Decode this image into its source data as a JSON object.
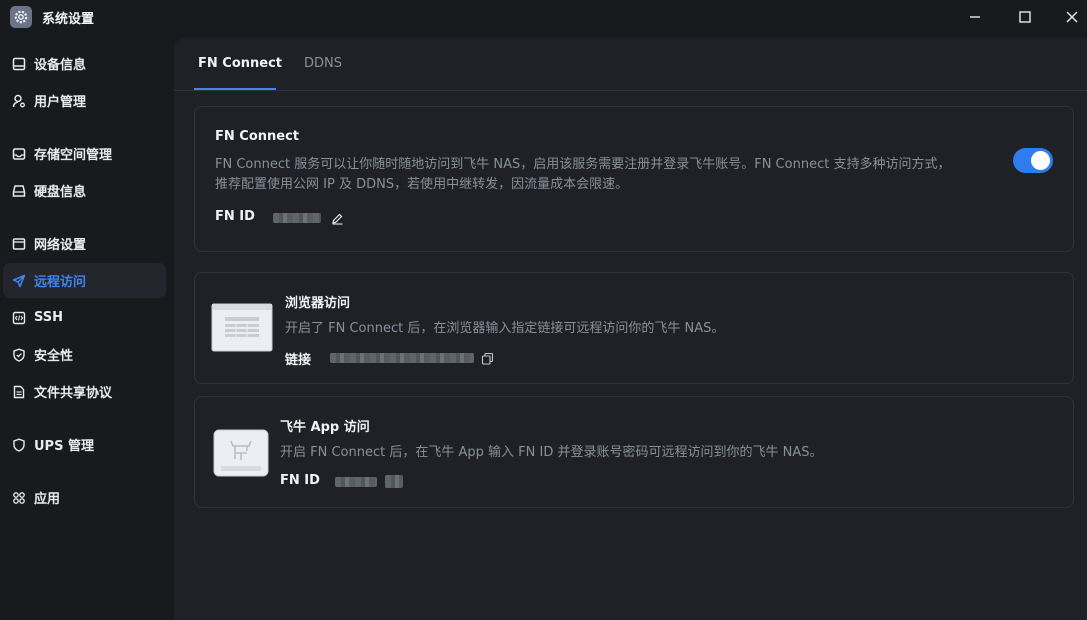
{
  "window": {
    "title": "系统设置",
    "icon": "gear-icon",
    "controls": [
      "minimize-icon",
      "maximize-icon",
      "close-icon"
    ]
  },
  "sidebar": {
    "items": [
      {
        "label": "设备信息",
        "icon": "monitor-icon",
        "active": false
      },
      {
        "label": "用户管理",
        "icon": "user-gear-icon",
        "active": false
      },
      {
        "label": "存储空间管理",
        "icon": "storage-icon",
        "active": false
      },
      {
        "label": "硬盘信息",
        "icon": "disk-icon",
        "active": false
      },
      {
        "label": "网络设置",
        "icon": "network-icon",
        "active": false
      },
      {
        "label": "远程访问",
        "icon": "send-icon",
        "active": true
      },
      {
        "label": "SSH",
        "icon": "code-icon",
        "active": false
      },
      {
        "label": "安全性",
        "icon": "shield-check-icon",
        "active": false
      },
      {
        "label": "文件共享协议",
        "icon": "document-icon",
        "active": false
      },
      {
        "label": "UPS 管理",
        "icon": "shield-icon",
        "active": false
      },
      {
        "label": "应用",
        "icon": "apps-icon",
        "active": false
      }
    ]
  },
  "tabs": [
    {
      "label": "FN Connect",
      "active": true
    },
    {
      "label": "DDNS",
      "active": false
    }
  ],
  "fn_connect_card": {
    "title": "FN Connect",
    "desc_line1": "FN Connect 服务可以让你随时随地访问到飞牛 NAS，启用该服务需要注册并登录飞牛账号。FN Connect 支持多种访问方式，",
    "desc_line2": "推荐配置使用公网 IP 及 DDNS，若使用中继转发，因流量成本会限速。",
    "id_label": "FN ID",
    "enabled": true
  },
  "browser_card": {
    "title": "浏览器访问",
    "desc": "开启了 FN Connect 后，在浏览器输入指定链接可远程访问你的飞牛 NAS。",
    "link_label": "链接"
  },
  "app_card": {
    "title": "飞牛 App 访问",
    "desc": "开启 FN Connect 后，在飞牛 App 输入 FN ID 并登录账号密码可远程访问到你的飞牛 NAS。",
    "id_label": "FN ID"
  },
  "colors": {
    "accent": "#3f86f2",
    "toggle_on": "#2f7bf0",
    "background": "#181a1e",
    "panel": "#1f2126",
    "muted_text": "#8a909b"
  }
}
